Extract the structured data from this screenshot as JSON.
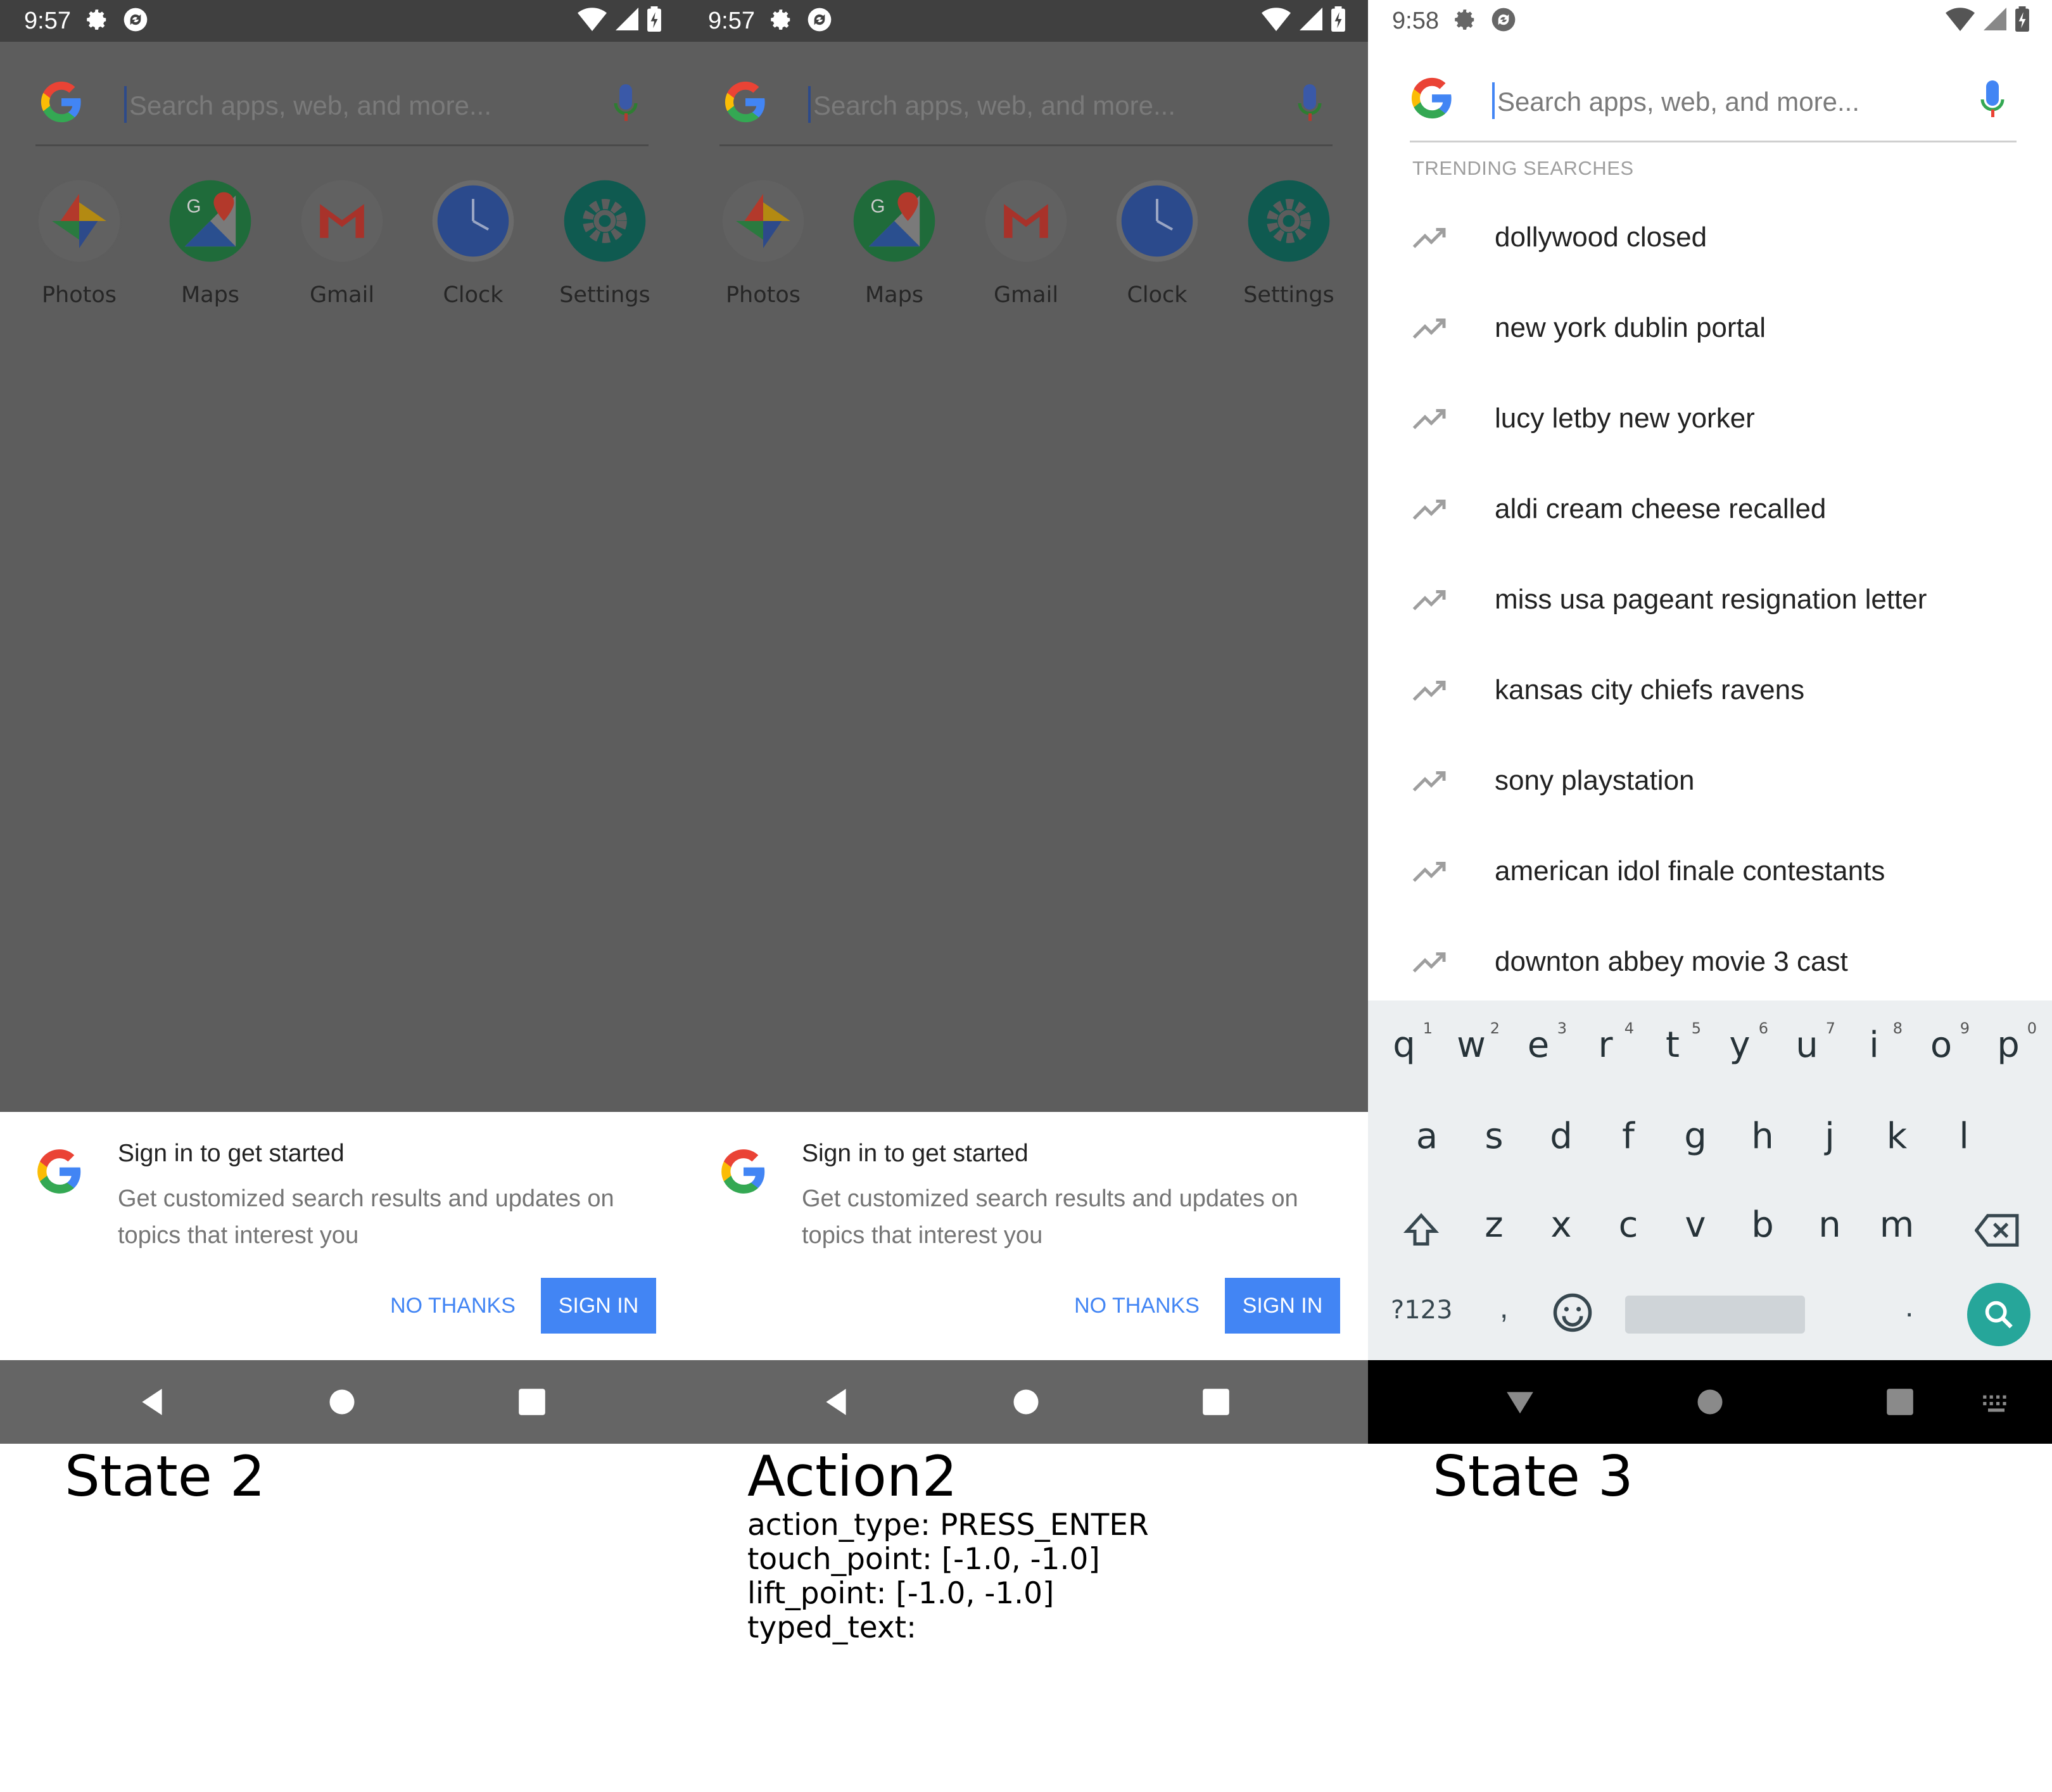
{
  "captions": {
    "state2": "State 2",
    "action2_title": "Action2",
    "action_type": "action_type: PRESS_ENTER",
    "touch_point": "touch_point: [-1.0, -1.0]",
    "lift_point": "lift_point: [-1.0, -1.0]",
    "typed_text": "typed_text:",
    "state3": "State 3"
  },
  "screen_a": {
    "time": "9:57",
    "search_placeholder": "Search apps, web, and more...",
    "apps": [
      {
        "label": "Photos",
        "icon": "pinwheel-photos-icon"
      },
      {
        "label": "Maps",
        "icon": "maps-icon"
      },
      {
        "label": "Gmail",
        "icon": "gmail-icon"
      },
      {
        "label": "Clock",
        "icon": "clock-icon"
      },
      {
        "label": "Settings",
        "icon": "gear-icon"
      }
    ],
    "dialog": {
      "title": "Sign in to get started",
      "desc": "Get customized search results and updates on topics that interest you",
      "no_thanks": "NO THANKS",
      "sign_in": "SIGN IN"
    }
  },
  "screen_b": {
    "time": "9:57",
    "search_placeholder": "Search apps, web, and more...",
    "apps": [
      {
        "label": "Photos"
      },
      {
        "label": "Maps"
      },
      {
        "label": "Gmail"
      },
      {
        "label": "Clock"
      },
      {
        "label": "Settings"
      }
    ],
    "dialog": {
      "title": "Sign in to get started",
      "desc": "Get customized search results and updates on topics that interest you",
      "no_thanks": "NO THANKS",
      "sign_in": "SIGN IN"
    }
  },
  "screen_c": {
    "time": "9:58",
    "search_placeholder": "Search apps, web, and more...",
    "trending_header": "TRENDING SEARCHES",
    "trending": [
      "dollywood closed",
      "new york dublin portal",
      "lucy letby new yorker",
      "aldi cream cheese recalled",
      "miss usa pageant resignation letter",
      "kansas city chiefs ravens",
      "sony playstation",
      "american idol finale contestants",
      "downton abbey movie 3 cast"
    ],
    "keyboard": {
      "row1": [
        "q",
        "w",
        "e",
        "r",
        "t",
        "y",
        "u",
        "i",
        "o",
        "p"
      ],
      "row1_hints": [
        "1",
        "2",
        "3",
        "4",
        "5",
        "6",
        "7",
        "8",
        "9",
        "0"
      ],
      "row2": [
        "a",
        "s",
        "d",
        "f",
        "g",
        "h",
        "j",
        "k",
        "l"
      ],
      "row3": [
        "z",
        "x",
        "c",
        "v",
        "b",
        "n",
        "m"
      ],
      "symbols": "?123",
      "comma": ",",
      "period": "."
    }
  },
  "colors": {
    "dim_bg": "#5d5d5d",
    "status_dark": "#404040",
    "accent_blue": "#4285f4",
    "search_teal": "#26a69a",
    "keyboard_bg": "#eceff1"
  }
}
